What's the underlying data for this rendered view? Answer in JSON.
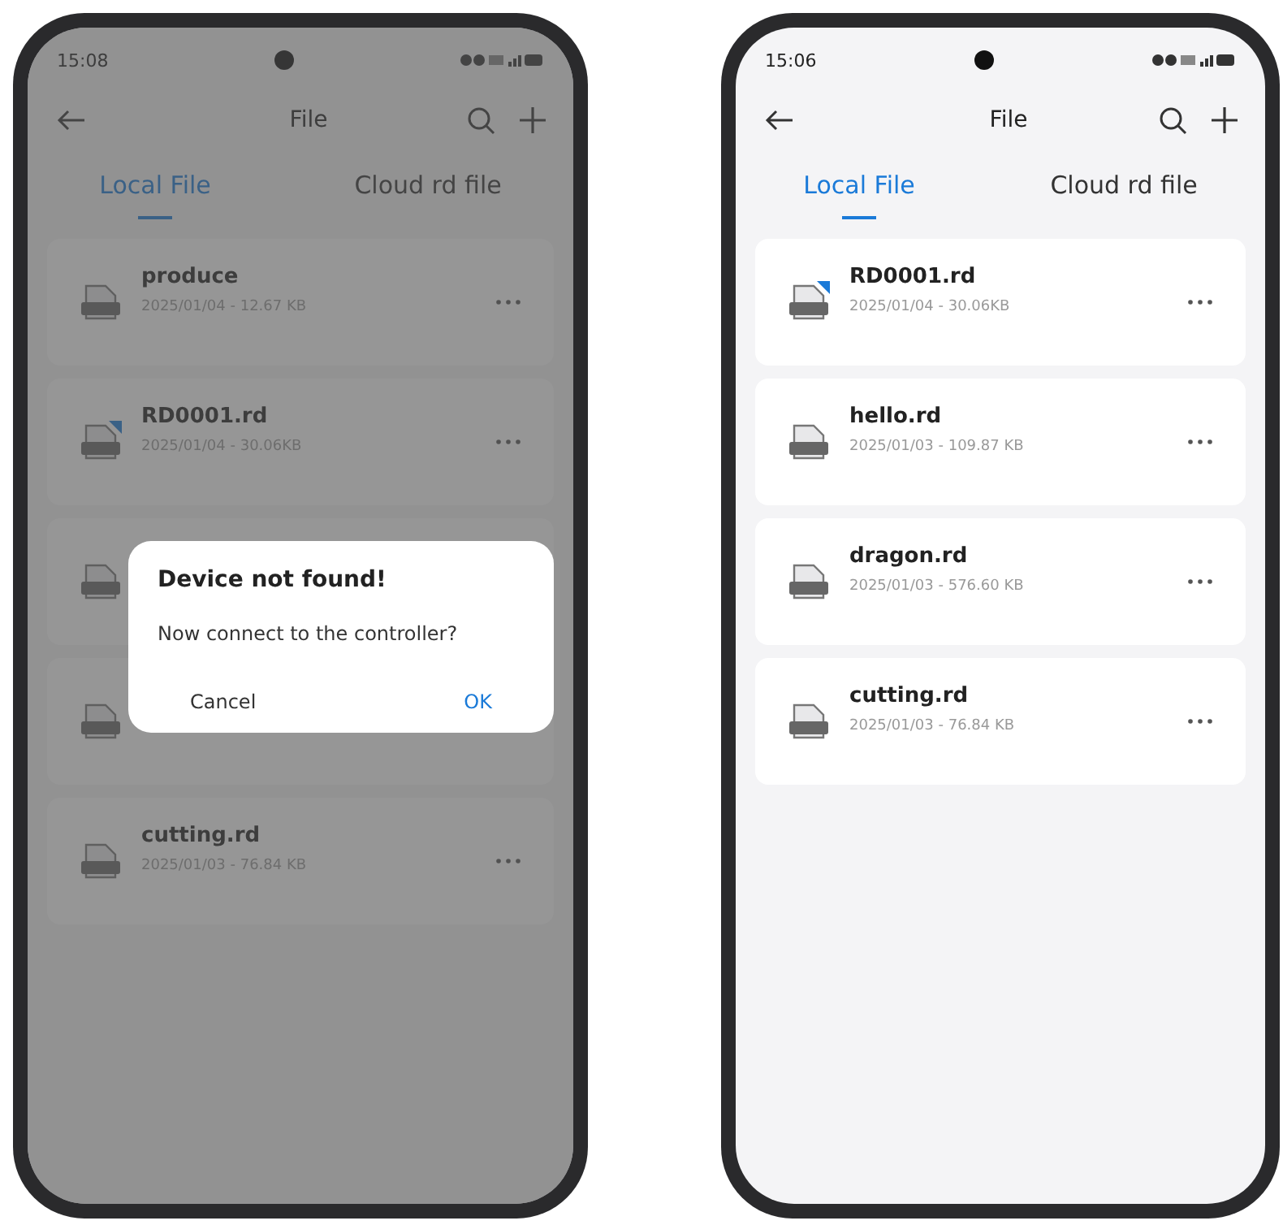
{
  "phones": [
    {
      "status_time": "15:08",
      "title": "File",
      "dimmed": true,
      "tabs": [
        {
          "label": "Local File",
          "selected": true
        },
        {
          "label": "Cloud rd file",
          "selected": false
        }
      ],
      "files": [
        {
          "kind": "file",
          "name": "produce",
          "meta": "2025/01/04 - 12.67 KB",
          "badge": false
        },
        {
          "kind": "file",
          "name": "RD0001.rd",
          "meta": "2025/01/04 - 30.06KB",
          "badge": true
        },
        {
          "kind": "covered"
        },
        {
          "kind": "covered"
        },
        {
          "kind": "file",
          "name": "cutting.rd",
          "meta": "2025/01/03 - 76.84 KB",
          "badge": false
        }
      ],
      "dialog": {
        "title": "Device not found!",
        "message": "Now connect to the controller?",
        "buttons": [
          {
            "label": "Cancel",
            "kind": "cancel"
          },
          {
            "label": "OK",
            "kind": "ok"
          }
        ]
      }
    },
    {
      "status_time": "15:06",
      "title": "File",
      "dimmed": false,
      "tabs": [
        {
          "label": "Local File",
          "selected": true
        },
        {
          "label": "Cloud rd file",
          "selected": false
        }
      ],
      "files": [
        {
          "kind": "file",
          "name": "RD0001.rd",
          "meta": "2025/01/04 - 30.06KB",
          "badge": true
        },
        {
          "kind": "file",
          "name": "hello.rd",
          "meta": "2025/01/03 - 109.87 KB",
          "badge": false
        },
        {
          "kind": "file",
          "name": "dragon.rd",
          "meta": "2025/01/03 - 576.60 KB",
          "badge": false
        },
        {
          "kind": "file",
          "name": "cutting.rd",
          "meta": "2025/01/03 - 76.84 KB",
          "badge": false
        }
      ]
    }
  ]
}
